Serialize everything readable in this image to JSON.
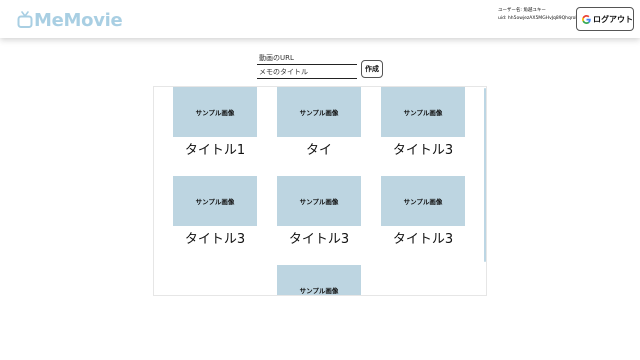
{
  "header": {
    "logo_text": "MeMovie",
    "user_name_line": "ユーザー名: 角越ユキー",
    "uid_line": "uid: hh5owjezAX5MGHvJq89Qhqroh9ct",
    "logout_label": "ログアウト"
  },
  "form": {
    "url_placeholder": "動画のURL",
    "title_placeholder": "メモのタイトル",
    "create_label": "作成"
  },
  "cards": [
    {
      "image_label": "サンプル画像",
      "title": "タイトル1"
    },
    {
      "image_label": "サンプル画像",
      "title": "タイ"
    },
    {
      "image_label": "サンプル画像",
      "title": "タイトル3"
    },
    {
      "image_label": "サンプル画像",
      "title": "タイトル3"
    },
    {
      "image_label": "サンプル画像",
      "title": "タイトル3"
    },
    {
      "image_label": "サンプル画像",
      "title": "タイトル3"
    },
    {
      "image_label": "サンプル画像",
      "title": ""
    }
  ],
  "colors": {
    "brand": "#a9cfe3",
    "thumbnail": "#bdd5e1"
  }
}
